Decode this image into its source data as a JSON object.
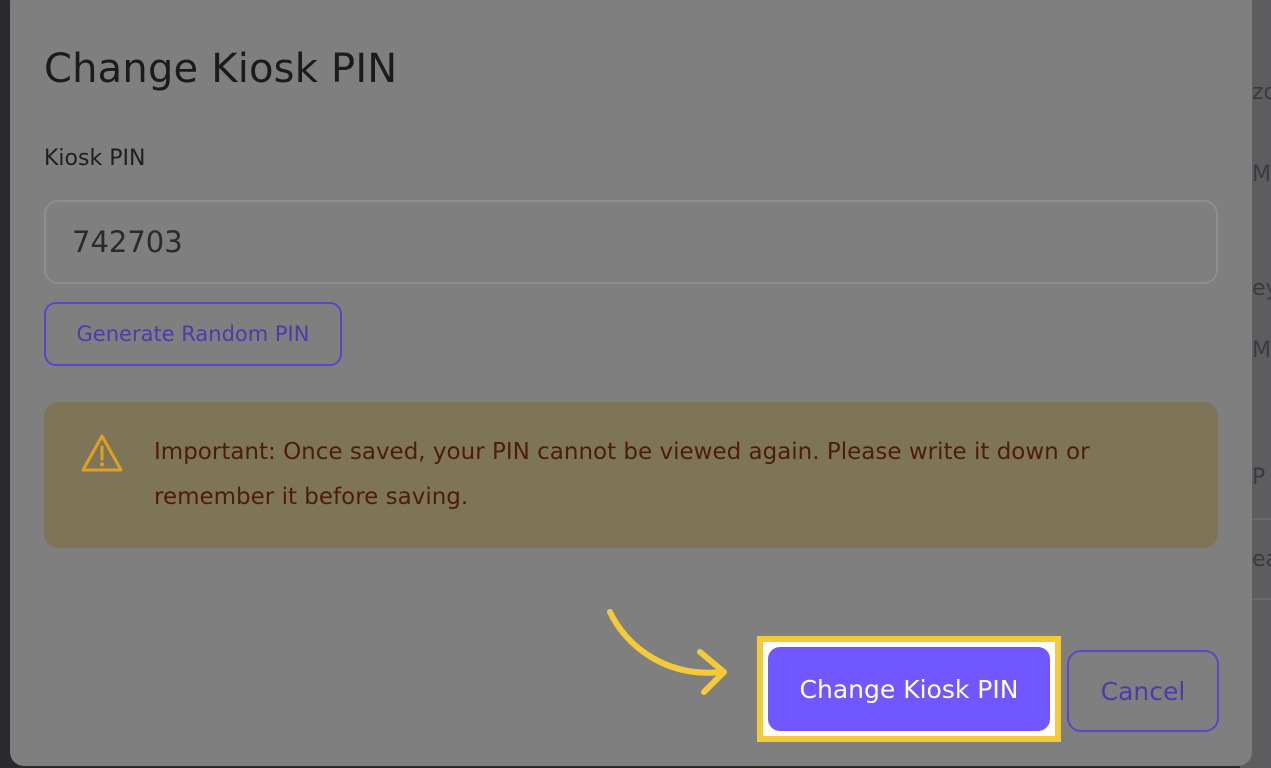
{
  "modal": {
    "title": "Change Kiosk PIN",
    "pin_label": "Kiosk PIN",
    "pin_value": "742703",
    "generate_button": "Generate Random PIN",
    "warning": {
      "icon": "warning-triangle-icon",
      "text": "Important: Once saved, your PIN cannot be viewed again. Please write it down or remember it before saving."
    },
    "primary_button": "Change Kiosk PIN",
    "cancel_button": "Cancel"
  },
  "background_page": {
    "fragments": [
      "zo",
      "M",
      "ey",
      "M",
      "P",
      "ea"
    ]
  },
  "colors": {
    "overlay": "#2a2a2e",
    "modal_bg": "#7f7f7f",
    "accent": "#7057ff",
    "accent_outline": "#5b45c9",
    "warning_bg": "#7e7559",
    "warning_text": "#4d1d08",
    "warning_icon": "#e0a020",
    "highlight": "#f3cb3a"
  }
}
